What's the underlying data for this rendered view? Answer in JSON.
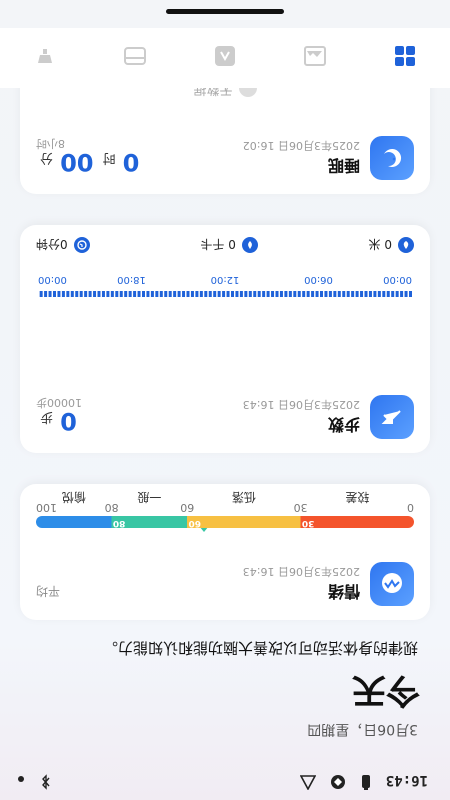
{
  "status": {
    "time": "16:43",
    "icons": [
      "signal-icon",
      "wifi-icon",
      "bluetooth-icon",
      "dot-icon"
    ]
  },
  "header": {
    "date": "3月06日，星期四",
    "title": "今天",
    "motto": "规律的身体活动可以改善大脑功能和认知能力。"
  },
  "mood": {
    "title": "情绪",
    "time": "2025年3月06日 16:43",
    "right_label": "平均",
    "scale_segment_values": [
      "30",
      "60",
      "80"
    ],
    "ticks": [
      "0",
      "30",
      "60",
      "80",
      "100"
    ],
    "labels": [
      "较差",
      "低落",
      "一般",
      "愉悦"
    ],
    "marker_value": 60,
    "colors": {
      "bad": "#f4542c",
      "low": "#f7c042",
      "normal": "#39c6a4",
      "happy": "#2d8de8"
    }
  },
  "steps": {
    "title": "步数",
    "time": "2025年3月06日 16:43",
    "value": "0",
    "unit": "步",
    "target": "10000步",
    "axis_ticks": [
      "00:00",
      "06:00",
      "12:00",
      "18:00",
      "00:00"
    ],
    "distance": "0 米",
    "calories": "0 千卡",
    "duration": "0分钟"
  },
  "sleep": {
    "title": "睡眠",
    "time": "2025年3月06日 16:02",
    "hours": "0",
    "hours_unit": "时",
    "minutes": "00",
    "minutes_unit": "分",
    "target": "8小时",
    "nodata": "无数据"
  },
  "tabs": [
    "tab-home",
    "tab-device",
    "tab-sport",
    "tab-health",
    "tab-profile"
  ]
}
